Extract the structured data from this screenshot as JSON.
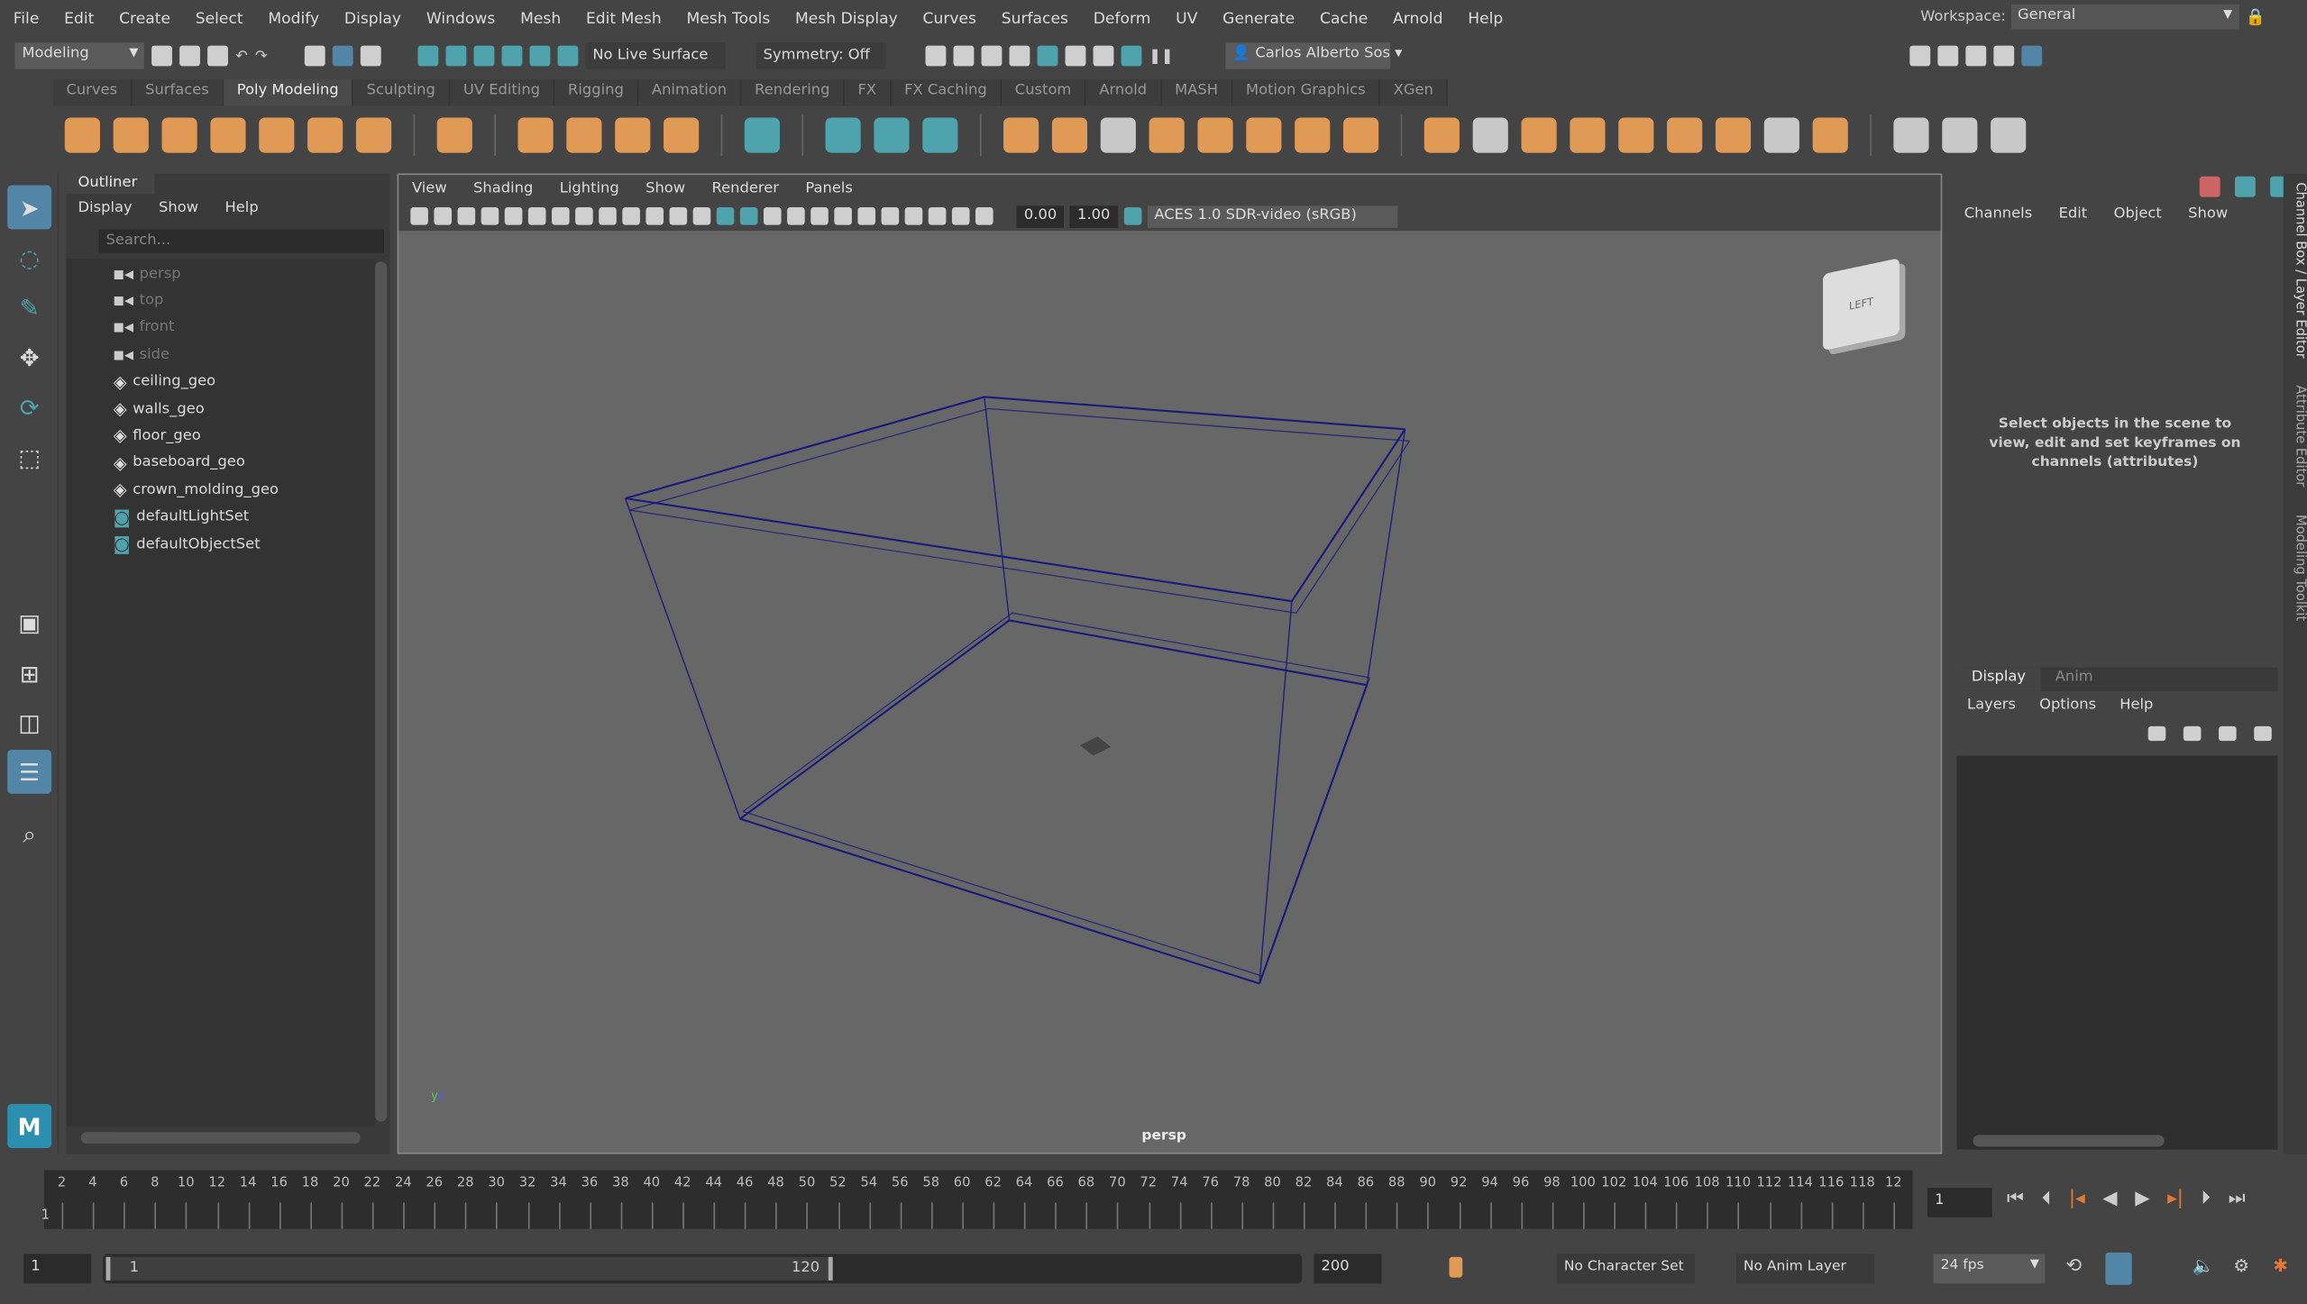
{
  "menubar": {
    "items": [
      "File",
      "Edit",
      "Create",
      "Select",
      "Modify",
      "Display",
      "Windows",
      "Mesh",
      "Edit Mesh",
      "Mesh Tools",
      "Mesh Display",
      "Curves",
      "Surfaces",
      "Deform",
      "UV",
      "Generate",
      "Cache",
      "Arnold",
      "Help"
    ],
    "workspace_label": "Workspace:",
    "workspace_value": "General"
  },
  "statusline": {
    "mode": "Modeling",
    "live_surface": "No Live Surface",
    "symmetry": "Symmetry: Off",
    "user": "Carlos Alberto Sos"
  },
  "shelf": {
    "tabs": [
      "Curves",
      "Surfaces",
      "Poly Modeling",
      "Sculpting",
      "UV Editing",
      "Rigging",
      "Animation",
      "Rendering",
      "FX",
      "FX Caching",
      "Custom",
      "Arnold",
      "MASH",
      "Motion Graphics",
      "XGen"
    ],
    "active_tab": "Poly Modeling"
  },
  "outliner": {
    "title": "Outliner",
    "menu": [
      "Display",
      "Show",
      "Help"
    ],
    "search_placeholder": "Search...",
    "items": [
      {
        "label": "persp",
        "icon": "camera-icon"
      },
      {
        "label": "top",
        "icon": "camera-icon"
      },
      {
        "label": "front",
        "icon": "camera-icon"
      },
      {
        "label": "side",
        "icon": "camera-icon"
      },
      {
        "label": "ceiling_geo",
        "icon": "mesh-icon"
      },
      {
        "label": "walls_geo",
        "icon": "mesh-icon"
      },
      {
        "label": "floor_geo",
        "icon": "mesh-icon"
      },
      {
        "label": "baseboard_geo",
        "icon": "mesh-icon"
      },
      {
        "label": "crown_molding_geo",
        "icon": "mesh-icon"
      },
      {
        "label": "defaultLightSet",
        "icon": "set-icon"
      },
      {
        "label": "defaultObjectSet",
        "icon": "set-icon"
      }
    ]
  },
  "viewport": {
    "menu": [
      "View",
      "Shading",
      "Lighting",
      "Show",
      "Renderer",
      "Panels"
    ],
    "exposure": "0.00",
    "gamma": "1.00",
    "color_space": "ACES 1.0 SDR-video (sRGB)",
    "camera_label": "persp",
    "view_cube_label": "LEFT",
    "wire_color": "#1a1a7a"
  },
  "channelbox": {
    "menu": [
      "Channels",
      "Edit",
      "Object",
      "Show"
    ],
    "message": "Select objects in the scene to view, edit and set keyframes on channels (attributes)",
    "layer_tabs": [
      "Display",
      "Anim"
    ],
    "layer_menu": [
      "Layers",
      "Options",
      "Help"
    ]
  },
  "side_tabs": [
    "Channel Box / Layer Editor",
    "Attribute Editor",
    "Modeling Toolkit"
  ],
  "timeline": {
    "ticks": [
      "2",
      "4",
      "6",
      "8",
      "10",
      "12",
      "14",
      "16",
      "18",
      "20",
      "22",
      "24",
      "26",
      "28",
      "30",
      "32",
      "34",
      "36",
      "38",
      "40",
      "42",
      "44",
      "46",
      "48",
      "50",
      "52",
      "54",
      "56",
      "58",
      "60",
      "62",
      "64",
      "66",
      "68",
      "70",
      "72",
      "74",
      "76",
      "78",
      "80",
      "82",
      "84",
      "86",
      "88",
      "90",
      "92",
      "94",
      "96",
      "98",
      "100",
      "102",
      "104",
      "106",
      "108",
      "110",
      "112",
      "114",
      "116",
      "118",
      "12"
    ],
    "current_frame_marker": "1",
    "current_frame": "1"
  },
  "range": {
    "start": "1",
    "range_start": "1",
    "range_end": "120",
    "end": "200",
    "character_set": "No Character Set",
    "anim_layer": "No Anim Layer",
    "fps": "24 fps"
  },
  "logo": "M"
}
